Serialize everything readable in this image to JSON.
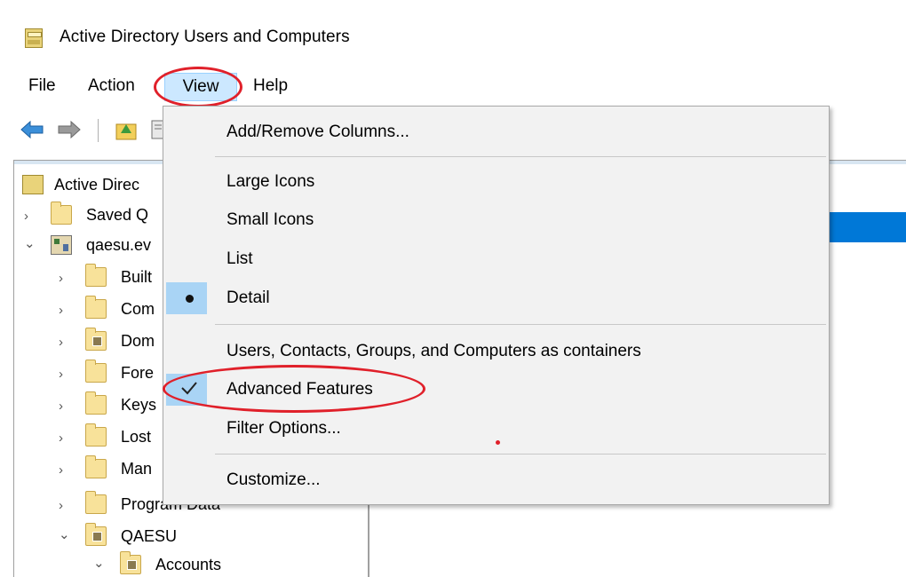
{
  "window": {
    "title": "Active Directory Users and Computers"
  },
  "menubar": {
    "file": "File",
    "action": "Action",
    "view": "View",
    "help": "Help"
  },
  "toolbar": {
    "icons": [
      "back-arrow-icon",
      "forward-arrow-icon",
      "up-folder-icon",
      "show-pane-icon"
    ]
  },
  "tree": {
    "items": [
      {
        "label": "Active Direc",
        "icon": "aduc-icon",
        "chevron": ""
      },
      {
        "label": "Saved Q",
        "icon": "folder-icon",
        "chevron": "›"
      },
      {
        "label": "qaesu.ev",
        "icon": "domain-icon",
        "chevron": "⌄"
      },
      {
        "label": "Built",
        "icon": "folder-icon",
        "chevron": "›"
      },
      {
        "label": "Com",
        "icon": "folder-icon",
        "chevron": "›"
      },
      {
        "label": "Dom",
        "icon": "ou-icon",
        "chevron": "›"
      },
      {
        "label": "Fore",
        "icon": "folder-icon",
        "chevron": "›"
      },
      {
        "label": "Keys",
        "icon": "folder-icon",
        "chevron": "›"
      },
      {
        "label": "Lost",
        "icon": "folder-icon",
        "chevron": "›"
      },
      {
        "label": "Man",
        "icon": "folder-icon",
        "chevron": "›"
      },
      {
        "label": "Program Data",
        "icon": "folder-icon",
        "chevron": "›"
      },
      {
        "label": "QAESU",
        "icon": "ou-icon",
        "chevron": "⌄"
      },
      {
        "label": "Accounts",
        "icon": "ou-icon",
        "chevron": "⌄"
      }
    ]
  },
  "view_menu": {
    "add_remove_columns": "Add/Remove Columns...",
    "large_icons": "Large Icons",
    "small_icons": "Small Icons",
    "list": "List",
    "detail": "Detail",
    "containers": "Users, Contacts, Groups, and Computers as containers",
    "advanced_features": "Advanced Features",
    "filter_options": "Filter Options...",
    "customize": "Customize...",
    "selected_view": "Detail",
    "advanced_features_checked": true
  },
  "colors": {
    "menu_highlight": "#cce8ff",
    "selection": "#0078d7",
    "annotation": "#e0202a",
    "check_box": "#a9d4f5"
  }
}
